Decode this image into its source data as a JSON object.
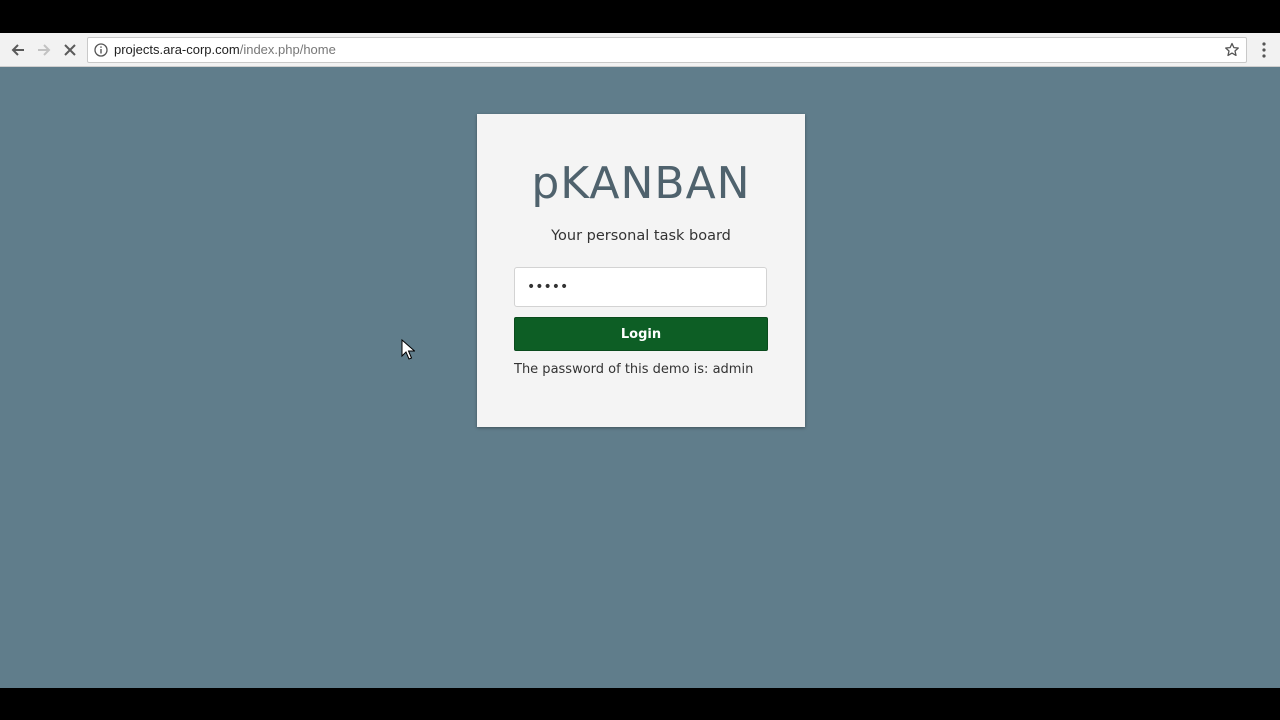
{
  "browser": {
    "url_host": "projects.ara-corp.com",
    "url_path": "/index.php/home",
    "icons": {
      "back": "arrow-left-icon",
      "forward": "arrow-right-icon",
      "stop": "close-icon",
      "info": "info-icon",
      "bookmark": "star-icon",
      "menu": "kebab-menu-icon"
    }
  },
  "login": {
    "brand": "pKANBAN",
    "tagline": "Your personal task board",
    "password_value": "admin",
    "login_label": "Login",
    "hint": "The password of this demo is: admin"
  },
  "colors": {
    "background": "#607d8b",
    "card": "#f4f4f4",
    "brand": "#4f626d",
    "button": "#0d5e25"
  }
}
